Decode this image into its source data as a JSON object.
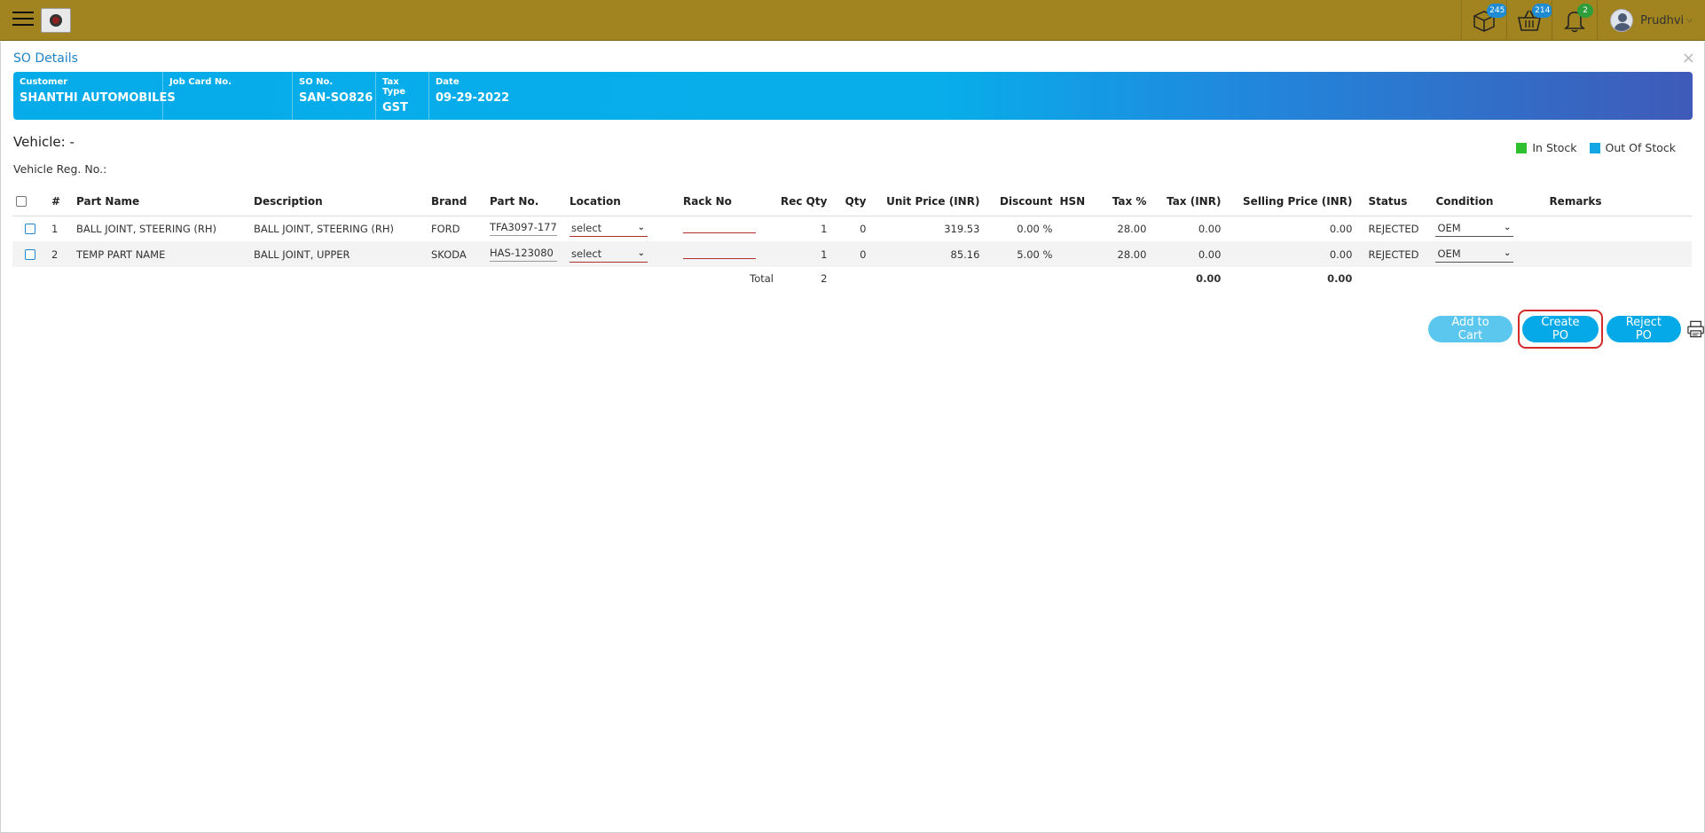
{
  "topbar": {
    "badges": {
      "packages": "245",
      "cart": "214",
      "notifications": "2"
    },
    "user_name": "Prudhvi"
  },
  "panel": {
    "title": "SO Details",
    "close_label": "×"
  },
  "info": [
    {
      "label": "Customer",
      "value": "SHANTHI AUTOMOBILES"
    },
    {
      "label": "Job Card No.",
      "value": ""
    },
    {
      "label": "SO No.",
      "value": "SAN-SO826"
    },
    {
      "label": "Tax Type",
      "value": "GST"
    },
    {
      "label": "Date",
      "value": "09-29-2022"
    }
  ],
  "vehicle": {
    "label": "Vehicle: -",
    "reg_label": "Vehicle Reg. No.:"
  },
  "legend": {
    "in_stock": {
      "label": "In Stock",
      "color": "#2fc02f"
    },
    "out_of_stock": {
      "label": "Out Of Stock",
      "color": "#13a7e6"
    }
  },
  "table": {
    "headers": [
      "#",
      "Part Name",
      "Description",
      "Brand",
      "Part No.",
      "Location",
      "Rack No",
      "Rec Qty",
      "Qty",
      "Unit Price (INR)",
      "Discount",
      "HSN",
      "Tax %",
      "Tax (INR)",
      "Selling Price (INR)",
      "Status",
      "Condition",
      "Remarks"
    ],
    "rows": [
      {
        "num": "1",
        "part_name": "BALL JOINT, STEERING (RH)",
        "description": "BALL JOINT, STEERING (RH)",
        "brand": "FORD",
        "part_no": "TFA3097-177",
        "location": "select",
        "rack": "",
        "rec_qty": "1",
        "qty": "0",
        "unit_price": "319.53",
        "discount": "0.00 %",
        "hsn": "",
        "tax_pct": "28.00",
        "tax_inr": "0.00",
        "selling_price": "0.00",
        "status": "REJECTED",
        "condition": "OEM",
        "remarks": ""
      },
      {
        "num": "2",
        "part_name": "TEMP PART NAME",
        "description": "BALL JOINT, UPPER",
        "brand": "SKODA",
        "part_no": "HAS-123080",
        "location": "select",
        "rack": "",
        "rec_qty": "1",
        "qty": "0",
        "unit_price": "85.16",
        "discount": "5.00 %",
        "hsn": "",
        "tax_pct": "28.00",
        "tax_inr": "0.00",
        "selling_price": "0.00",
        "status": "REJECTED",
        "condition": "OEM",
        "remarks": ""
      }
    ],
    "total": {
      "label": "Total",
      "rec_qty": "2",
      "tax_inr": "0.00",
      "selling_price": "0.00"
    }
  },
  "actions": {
    "add_to_cart": "Add to Cart",
    "create_po": "Create PO",
    "reject_po": "Reject PO"
  }
}
